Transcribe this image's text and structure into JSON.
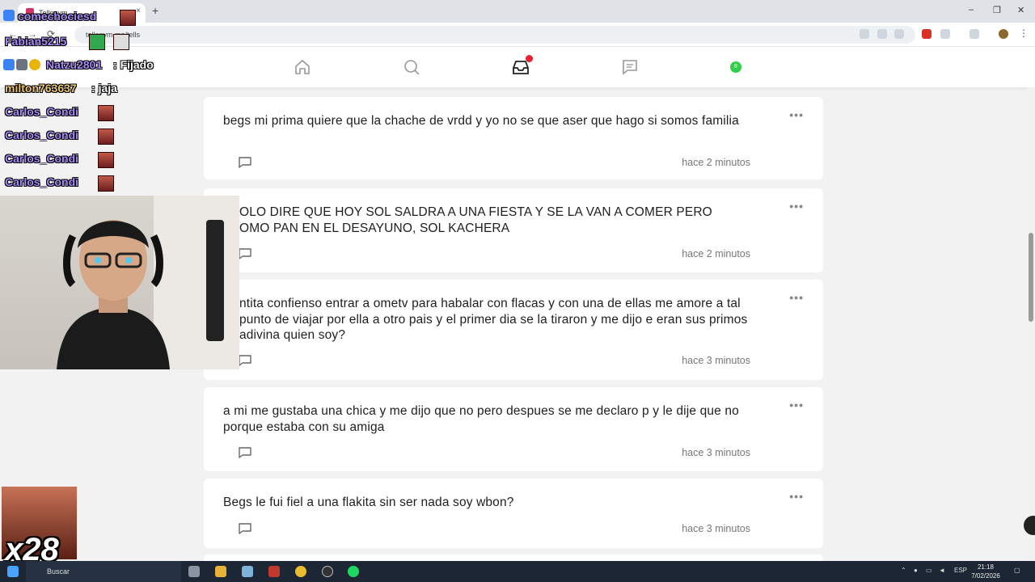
{
  "browser": {
    "tab_title": "Tellonym",
    "tab_close": "×",
    "new_tab": "+",
    "url": "tellonym.me/tells",
    "window_controls": [
      "–",
      "❐",
      "✕"
    ]
  },
  "app_nav": {
    "items": [
      "home-icon",
      "search-icon",
      "inbox-icon",
      "chat-icon",
      "profile-icon"
    ],
    "profile_initial": "8"
  },
  "tells": [
    {
      "text": "begs mi prima quiere que la chache de vrdd y yo no se que aser que hago si somos familia",
      "time": "hace 2 minutos"
    },
    {
      "text": "OLO DIRE QUE HOY SOL SALDRA A UNA FIESTA Y SE LA VAN A COMER PERO OMO PAN EN EL DESAYUNO, SOL KACHERA",
      "time": "hace 2 minutos"
    },
    {
      "text": "ntita confienso entrar a ometv para habalar con flacas y con una de ellas me amore a tal punto de viajar por ella a otro pais y el primer dia se la tiraron y me dijo e eran sus primos adivina quien soy?",
      "time": "hace 3 minutos"
    },
    {
      "text": "a mi me gustaba una chica y me dijo que no pero despues se me declaro p y le dije que no porque estaba con su amiga",
      "time": "hace 3 minutos"
    },
    {
      "text": "Begs le fui fiel a una flakita sin ser nada soy wbon?",
      "time": "hace 3 minutos"
    }
  ],
  "more_glyph": "•••",
  "chat": [
    {
      "user": "comechociesd",
      "msg": ""
    },
    {
      "user": "Fabian5215",
      "msg": ""
    },
    {
      "user": "Natzu2801",
      "msg": "Fijado"
    },
    {
      "user": "milton763637",
      "msg": "jaja"
    },
    {
      "user": "Carlos_Condi",
      "msg": ""
    },
    {
      "user": "Carlos_Condi",
      "msg": ""
    },
    {
      "user": "Carlos_Condi",
      "msg": ""
    },
    {
      "user": "Carlos_Condi",
      "msg": ""
    }
  ],
  "combo": "x28",
  "taskbar": {
    "search_placeholder": "Buscar",
    "lang": "ESP",
    "time": "21:18",
    "date": "7/02/2026"
  },
  "colors": {
    "notification": "#e8212f",
    "online": "#2fcf4a",
    "chat_name": "#a78bfa"
  }
}
